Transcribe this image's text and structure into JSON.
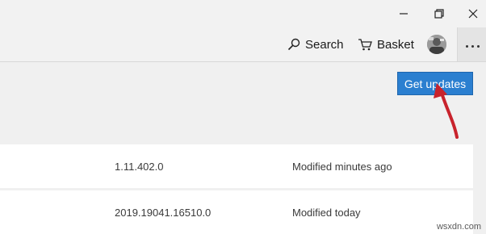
{
  "window": {
    "controls": [
      "minimize-icon",
      "restore-icon",
      "close-icon"
    ]
  },
  "appbar": {
    "search_label": "Search",
    "basket_label": "Basket",
    "search_icon": "search-icon",
    "basket_icon": "basket-icon",
    "more_icon": "more-dots-icon"
  },
  "actions": {
    "get_updates_label": "Get updates",
    "accent": "#2b7fd0"
  },
  "rows": [
    {
      "version": "1.11.402.0",
      "modified": "Modified minutes ago"
    },
    {
      "version": "2019.19041.16510.0",
      "modified": "Modified today"
    }
  ],
  "annotation": {
    "arrow_color": "#c8232c"
  },
  "watermark": "wsxdn.com"
}
